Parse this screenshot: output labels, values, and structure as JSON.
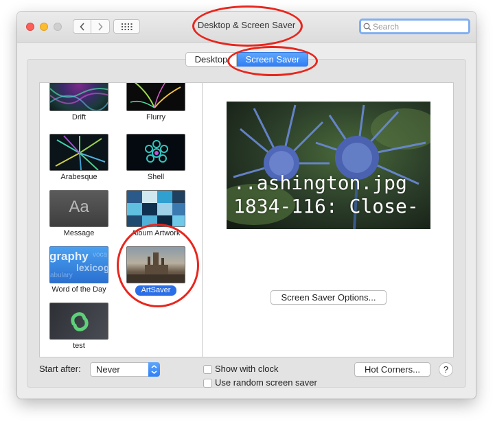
{
  "window": {
    "title": "Desktop & Screen Saver"
  },
  "search": {
    "placeholder": "Search",
    "value": ""
  },
  "tabs": [
    {
      "label": "Desktop",
      "active": false
    },
    {
      "label": "Screen Saver",
      "active": true
    }
  ],
  "savers": [
    {
      "label": "Drift",
      "thumb": "drift"
    },
    {
      "label": "Flurry",
      "thumb": "flurry"
    },
    {
      "label": "Arabesque",
      "thumb": "arabesque"
    },
    {
      "label": "Shell",
      "thumb": "shell"
    },
    {
      "label": "Message",
      "thumb": "message",
      "thumb_text": "Aa"
    },
    {
      "label": "Album Artwork",
      "thumb": "album"
    },
    {
      "label": "Word of the Day",
      "thumb": "word",
      "thumb_text": "graphy",
      "thumb_text2": "lexicog",
      "thumb_text3": "abulary",
      "thumb_text4": "voca"
    },
    {
      "label": "ArtSaver",
      "thumb": "artsaver",
      "selected": true
    },
    {
      "label": "test",
      "thumb": "test"
    }
  ],
  "preview": {
    "line1": "..ashington.jpg",
    "line2": "1834-116: Close-"
  },
  "options_button": "Screen Saver Options...",
  "start_after": {
    "label": "Start after:",
    "value": "Never"
  },
  "show_clock": {
    "label": "Show with clock",
    "checked": false
  },
  "random_saver": {
    "label": "Use random screen saver",
    "checked": false
  },
  "hot_corners": "Hot Corners...",
  "help": "?",
  "colors": {
    "accent": "#2f7ff6",
    "annotation": "#e8261d"
  }
}
